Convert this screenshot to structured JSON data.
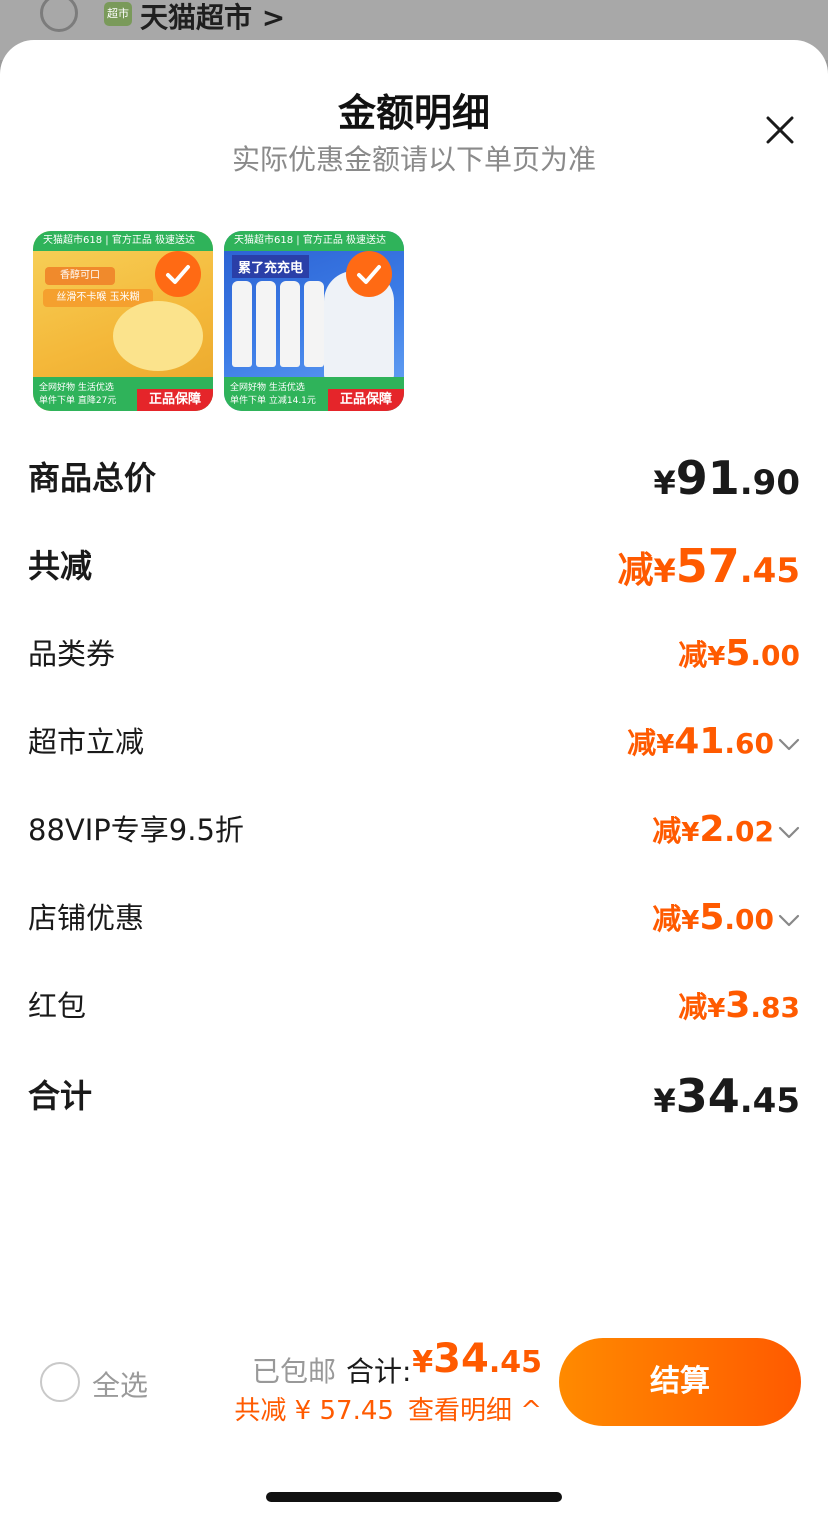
{
  "background": {
    "store_icon_text": "超市",
    "store_name": "天猫超市 >"
  },
  "sheet": {
    "title": "金额明细",
    "subtitle": "实际优惠金额请以下单页为准",
    "close_icon": "close-icon"
  },
  "products": [
    {
      "band_top": "天猫超市618 | 官方正品 极速送达",
      "tag1": "香醇可口",
      "tag2": "丝滑不卡喉 玉米糊",
      "bottom_text": "全网好物 生活优选",
      "bottom_promo": "单件下单 直降27元",
      "badge": "正品保障"
    },
    {
      "band_top": "天猫超市618 | 官方正品 极速送达",
      "headline": "累了充充电",
      "bottom_text": "全网好物 生活优选",
      "bottom_promo": "单件下单 立减14.1元",
      "badge": "正品保障"
    }
  ],
  "rows": {
    "subtotal": {
      "label": "商品总价",
      "yen": "¥",
      "int": "91",
      "dec": ".90"
    },
    "total_discount": {
      "label": "共减",
      "prefix": "减",
      "yen": "¥",
      "int": "57",
      "dec": ".45"
    },
    "category_coupon": {
      "label": "品类券",
      "prefix": "减",
      "yen": "¥",
      "int": "5",
      "dec": ".00"
    },
    "market_discount": {
      "label": "超市立减",
      "prefix": "减",
      "yen": "¥",
      "int": "41",
      "dec": ".60"
    },
    "vip_discount": {
      "label": "88VIP专享9.5折",
      "prefix": "减",
      "yen": "¥",
      "int": "2",
      "dec": ".02"
    },
    "store_discount": {
      "label": "店铺优惠",
      "prefix": "减",
      "yen": "¥",
      "int": "5",
      "dec": ".00"
    },
    "red_packet": {
      "label": "红包",
      "prefix": "减",
      "yen": "¥",
      "int": "3",
      "dec": ".83"
    },
    "total": {
      "label": "合计",
      "yen": "¥",
      "int": "34",
      "dec": ".45"
    }
  },
  "bottom_bar": {
    "select_all": "全选",
    "shipping": "已包邮",
    "total_label": "合计:",
    "total_yen": "¥",
    "total_int": "34",
    "total_dec": ".45",
    "saved": "共减 ¥ 57.45",
    "view_detail": "查看明细 ^",
    "checkout": "结算"
  },
  "colors": {
    "accent": "#ff5a00",
    "button_gradient_start": "#ff8a00",
    "button_gradient_end": "#ff5a00"
  }
}
